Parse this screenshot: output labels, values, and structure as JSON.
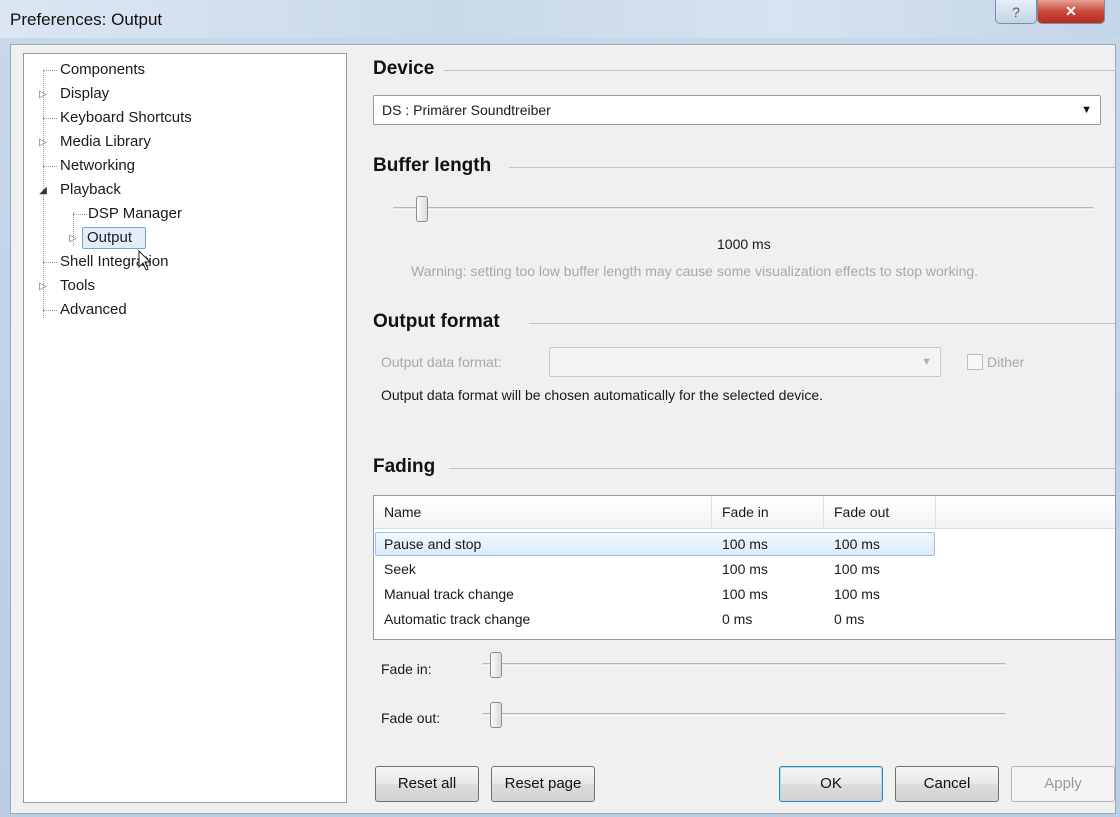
{
  "window": {
    "title": "Preferences: Output",
    "help_glyph": "?",
    "close_glyph": "✕"
  },
  "tree": {
    "items": [
      {
        "label": "Components"
      },
      {
        "label": "Display"
      },
      {
        "label": "Keyboard Shortcuts"
      },
      {
        "label": "Media Library"
      },
      {
        "label": "Networking"
      },
      {
        "label": "Playback"
      },
      {
        "label": "DSP Manager"
      },
      {
        "label": "Output"
      },
      {
        "label": "Shell Integration"
      },
      {
        "label": "Tools"
      },
      {
        "label": "Advanced"
      }
    ]
  },
  "device": {
    "title": "Device",
    "selected": "DS : Primärer Soundtreiber"
  },
  "buffer": {
    "title": "Buffer length",
    "value_label": "1000 ms",
    "warning": "Warning: setting too low buffer length may cause some visualization effects to stop working."
  },
  "output_format": {
    "title": "Output format",
    "label": "Output data format:",
    "selected": "",
    "dither_label": "Dither",
    "note": "Output data format will be chosen automatically for the selected device."
  },
  "fading": {
    "title": "Fading",
    "columns": [
      "Name",
      "Fade in",
      "Fade out"
    ],
    "rows": [
      {
        "name": "Pause and stop",
        "fade_in": "100 ms",
        "fade_out": "100 ms"
      },
      {
        "name": "Seek",
        "fade_in": "100 ms",
        "fade_out": "100 ms"
      },
      {
        "name": "Manual track change",
        "fade_in": "100 ms",
        "fade_out": "100 ms"
      },
      {
        "name": "Automatic track change",
        "fade_in": "0 ms",
        "fade_out": "0 ms"
      }
    ],
    "fade_in_label": "Fade in:",
    "fade_out_label": "Fade out:"
  },
  "buttons": {
    "reset_all": "Reset all",
    "reset_page": "Reset page",
    "ok": "OK",
    "cancel": "Cancel",
    "apply": "Apply"
  }
}
